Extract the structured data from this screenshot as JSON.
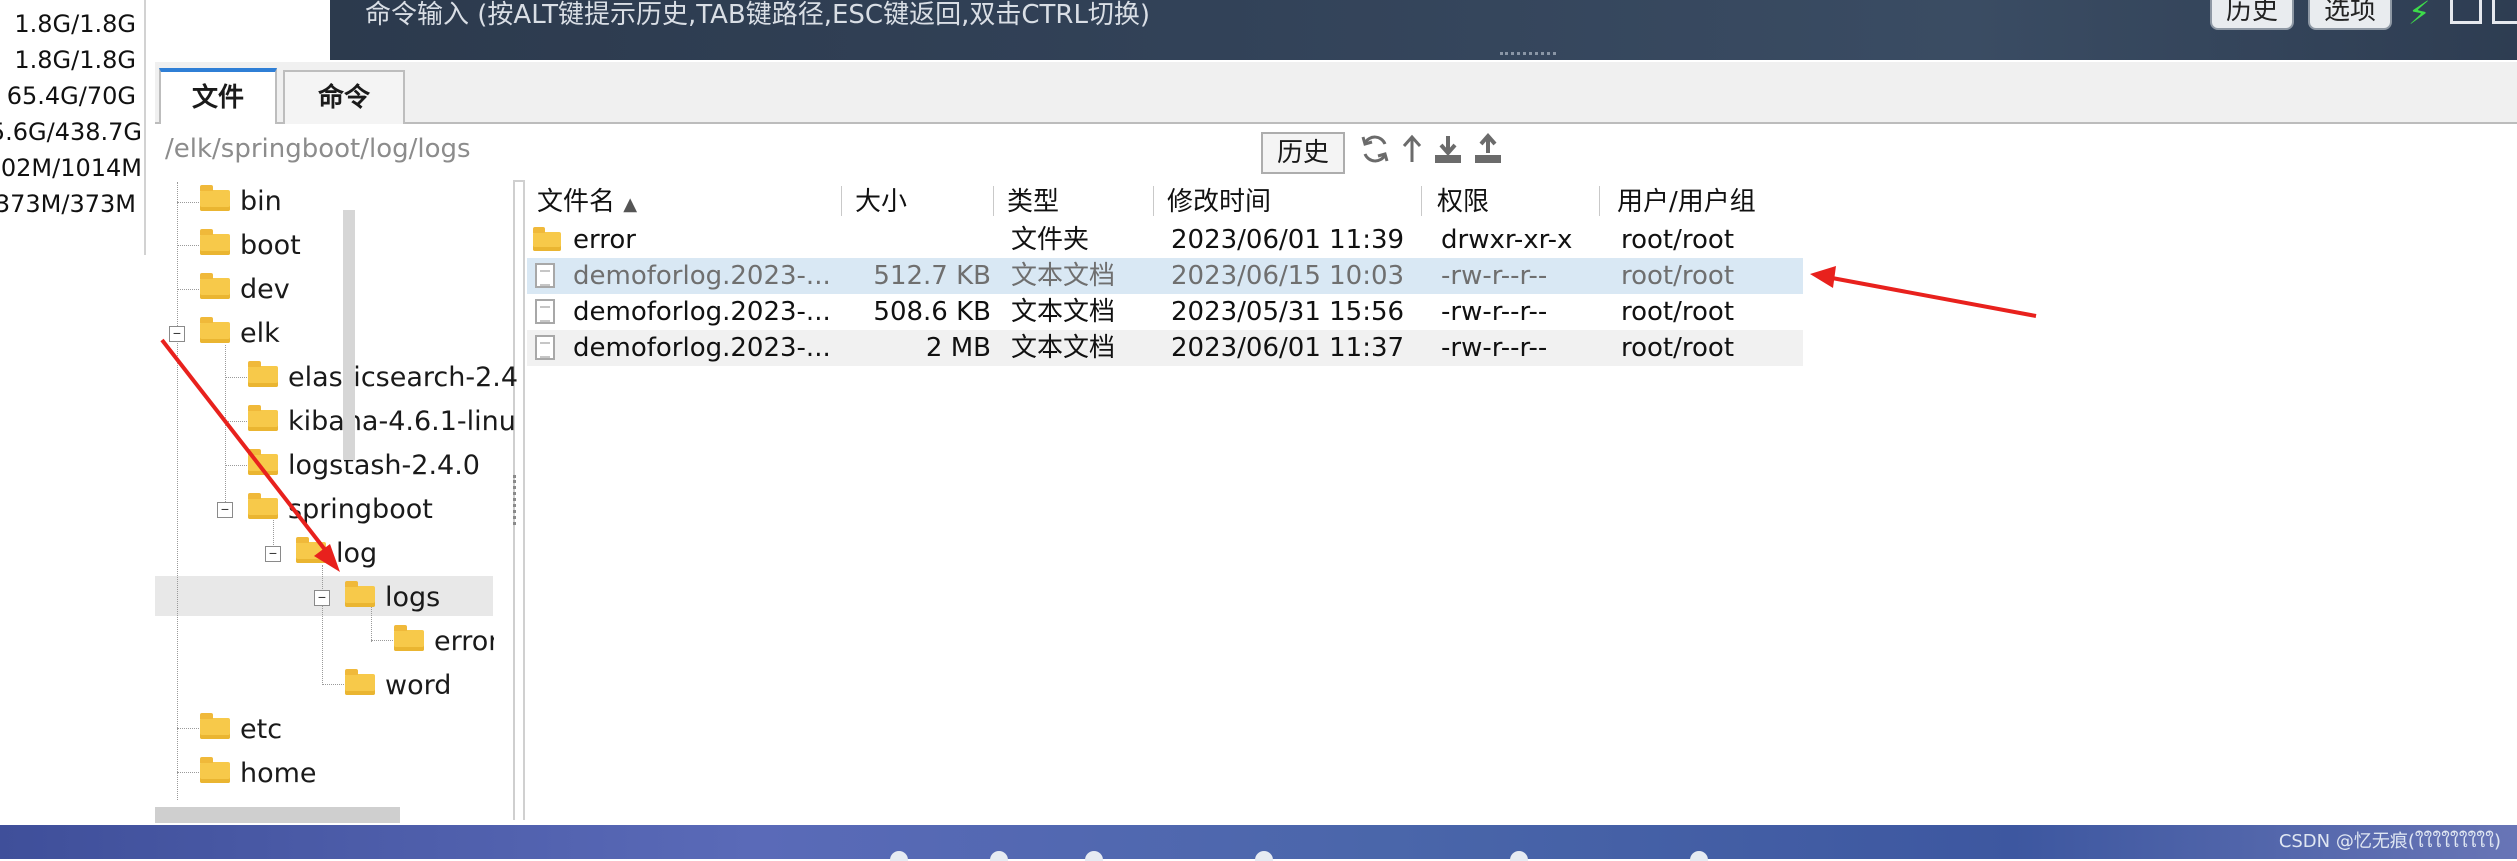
{
  "topbar": {
    "command_hint": "命令输入 (按ALT键提示历史,TAB键路径,ESC键返回,双击CTRL切换)",
    "history_btn": "历史",
    "options_btn": "选项"
  },
  "resources": [
    "1.8G/1.8G",
    "1.8G/1.8G",
    "65.4G/70G",
    "5.6G/438.7G",
    "02M/1014M",
    "373M/373M"
  ],
  "tabs": {
    "files": "文件",
    "commands": "命令"
  },
  "pathbar": {
    "path": "/elk/springboot/log/logs",
    "history_btn": "历史"
  },
  "tree": {
    "bin": "bin",
    "boot": "boot",
    "dev": "dev",
    "elk": "elk",
    "elasticsearch": "elasticsearch-2.4",
    "kibana": "kibana-4.6.1-linu",
    "logstash": "logstash-2.4.0",
    "springboot": "springboot",
    "log": "log",
    "logs": "logs",
    "error": "error",
    "word": "word",
    "etc": "etc",
    "home": "home"
  },
  "columns": {
    "name": "文件名",
    "size": "大小",
    "type": "类型",
    "modified": "修改时间",
    "perm": "权限",
    "owner": "用户/用户组"
  },
  "files": [
    {
      "name": "error",
      "size": "",
      "type": "文件夹",
      "modified": "2023/06/01 11:39",
      "perm": "drwxr-xr-x",
      "owner": "root/root"
    },
    {
      "name": "demoforlog.2023-...",
      "size": "512.7 KB",
      "type": "文本文档",
      "modified": "2023/06/15 10:03",
      "perm": "-rw-r--r--",
      "owner": "root/root"
    },
    {
      "name": "demoforlog.2023-...",
      "size": "508.6 KB",
      "type": "文本文档",
      "modified": "2023/05/31 15:56",
      "perm": "-rw-r--r--",
      "owner": "root/root"
    },
    {
      "name": "demoforlog.2023-...",
      "size": "2 MB",
      "type": "文本文档",
      "modified": "2023/06/01 11:37",
      "perm": "-rw-r--r--",
      "owner": "root/root"
    }
  ],
  "watermark": "CSDN @忆无痕(ใใใใใใใใใ)",
  "colors": {
    "annotation_arrow": "#e8211d",
    "selected_row": "#d9e8f4",
    "folder": "#f7c94a",
    "tab_accent": "#2f7fd6"
  }
}
